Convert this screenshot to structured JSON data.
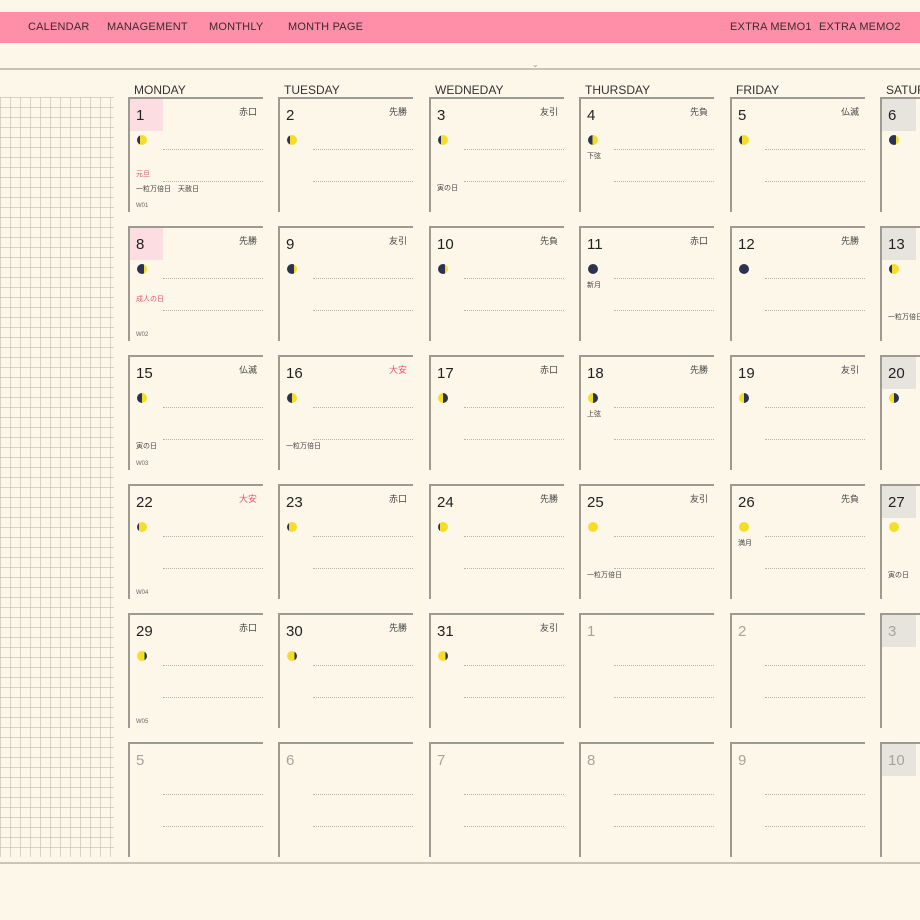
{
  "nav": {
    "left": [
      "CALENDAR",
      "MANAGEMENT",
      "MONTHLY",
      "MONTH PAGE"
    ],
    "right": [
      "EXTRA MEMO1",
      "EXTRA MEMO2"
    ]
  },
  "collapse_glyph": "⌄",
  "weekdays": [
    "MONDAY",
    "TUESDAY",
    "WEDNEDAY",
    "THURSDAY",
    "FRIDAY",
    "SATUR"
  ],
  "weeks": [
    {
      "week": "W01",
      "days": [
        {
          "day": "1",
          "rokuyo": "赤口",
          "moon": "waxing-crescent",
          "today": true,
          "notes": [
            {
              "text": "元旦",
              "red": true
            },
            {
              "text": "一粒万倍日　天赦日"
            }
          ]
        },
        {
          "day": "2",
          "rokuyo": "先勝",
          "moon": "waxing-crescent"
        },
        {
          "day": "3",
          "rokuyo": "友引",
          "moon": "waxing-crescent",
          "notes": [
            {
              "text": "寅の日"
            }
          ]
        },
        {
          "day": "4",
          "rokuyo": "先負",
          "moon": "first-quarter",
          "notes": [
            {
              "text": "下弦"
            }
          ]
        },
        {
          "day": "5",
          "rokuyo": "仏滅",
          "moon": "waxing-crescent"
        },
        {
          "day": "6",
          "moon": "waning-crescent",
          "sat": true
        }
      ]
    },
    {
      "week": "W02",
      "days": [
        {
          "day": "8",
          "rokuyo": "先勝",
          "moon": "waning-crescent",
          "today": true,
          "notes": [
            {
              "text": "成人の日",
              "red": true
            }
          ]
        },
        {
          "day": "9",
          "rokuyo": "友引",
          "moon": "waning-crescent"
        },
        {
          "day": "10",
          "rokuyo": "先負",
          "moon": "waning-crescent"
        },
        {
          "day": "11",
          "rokuyo": "赤口",
          "moon": "new",
          "notes": [
            {
              "text": "新月"
            }
          ]
        },
        {
          "day": "12",
          "rokuyo": "先勝",
          "moon": "new"
        },
        {
          "day": "13",
          "moon": "waxing-crescent",
          "sat": true,
          "notes": [
            {
              "text": "一粒万倍日"
            }
          ]
        }
      ]
    },
    {
      "week": "W03",
      "days": [
        {
          "day": "15",
          "rokuyo": "仏滅",
          "moon": "half-left",
          "notes": [
            {
              "text": "寅の日"
            }
          ]
        },
        {
          "day": "16",
          "rokuyo": "大安",
          "rokuyo_red": true,
          "moon": "half-left",
          "notes": [
            {
              "text": "一粒万倍日"
            }
          ]
        },
        {
          "day": "17",
          "rokuyo": "赤口",
          "moon": "half-right"
        },
        {
          "day": "18",
          "rokuyo": "先勝",
          "moon": "half-right",
          "notes": [
            {
              "text": "上弦"
            }
          ]
        },
        {
          "day": "19",
          "rokuyo": "友引",
          "moon": "half-right"
        },
        {
          "day": "20",
          "moon": "half-right",
          "sat": true
        }
      ]
    },
    {
      "week": "W04",
      "days": [
        {
          "day": "22",
          "rokuyo": "大安",
          "rokuyo_red": true,
          "moon": "gibbous"
        },
        {
          "day": "23",
          "rokuyo": "赤口",
          "moon": "gibbous"
        },
        {
          "day": "24",
          "rokuyo": "先勝",
          "moon": "gibbous"
        },
        {
          "day": "25",
          "rokuyo": "友引",
          "moon": "full",
          "notes": [
            {
              "text": "一粒万倍日"
            }
          ]
        },
        {
          "day": "26",
          "rokuyo": "先負",
          "moon": "full",
          "notes": [
            {
              "text": "満月"
            }
          ]
        },
        {
          "day": "27",
          "moon": "full",
          "sat": true,
          "notes": [
            {
              "text": "寅の日"
            }
          ]
        }
      ]
    },
    {
      "week": "W05",
      "days": [
        {
          "day": "29",
          "rokuyo": "赤口",
          "moon": "waning-gibbous"
        },
        {
          "day": "30",
          "rokuyo": "先勝",
          "moon": "waning-gibbous"
        },
        {
          "day": "31",
          "rokuyo": "友引",
          "moon": "waning-gibbous"
        },
        {
          "day": "1",
          "gray": true
        },
        {
          "day": "2",
          "gray": true
        },
        {
          "day": "3",
          "gray": true,
          "sat": true
        }
      ]
    },
    {
      "week": "",
      "days": [
        {
          "day": "5",
          "gray": true
        },
        {
          "day": "6",
          "gray": true
        },
        {
          "day": "7",
          "gray": true
        },
        {
          "day": "8",
          "gray": true
        },
        {
          "day": "9",
          "gray": true
        },
        {
          "day": "10",
          "gray": true,
          "sat": true
        }
      ]
    }
  ],
  "colors": {
    "nav_bg": "#ff8fa8",
    "page_bg": "#fdf7ea",
    "holiday_red": "#e85470",
    "today_bg": "#fcdde2",
    "moon_yellow": "#f5dd2a",
    "moon_navy": "#2b3350"
  }
}
